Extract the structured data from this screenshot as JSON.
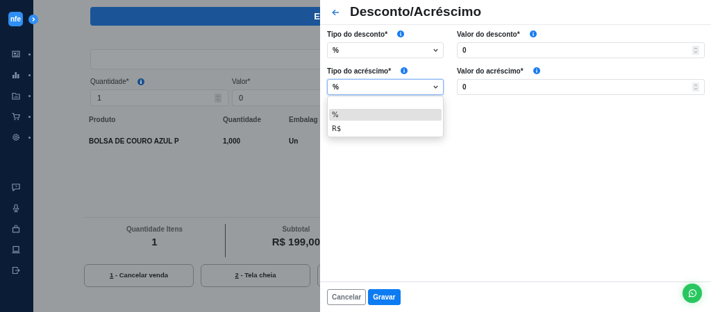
{
  "sidebar": {
    "logo": "nfe"
  },
  "background": {
    "banner_text": "E",
    "fields": [
      {
        "label": "Quantidade*",
        "info": true,
        "value": "1",
        "kind": "number"
      },
      {
        "label": "Valor*",
        "info": false,
        "value": "0",
        "kind": "text"
      }
    ],
    "table": {
      "columns": [
        "Produto",
        "Quantidade",
        "Embalag"
      ],
      "rows": [
        [
          "BOLSA DE COURO AZUL P",
          "1,000",
          "Un"
        ]
      ]
    },
    "summary": [
      {
        "label": "Quantidade Itens",
        "value": "1"
      },
      {
        "label": "Subtotal",
        "value": "R$ 199,00"
      }
    ],
    "actions": [
      {
        "shortcut": "1",
        "label": " - Cancelar venda"
      },
      {
        "shortcut": "2",
        "label": " - Tela cheia"
      }
    ]
  },
  "panel": {
    "title": "Desconto/Acréscimo",
    "fields": [
      {
        "label": "Tipo do desconto*",
        "kind": "select",
        "value": "%",
        "focused": false
      },
      {
        "label": "Valor do desconto*",
        "kind": "number",
        "value": "0",
        "focused": false
      },
      {
        "label": "Tipo do acréscimo*",
        "kind": "select",
        "value": "%",
        "focused": true,
        "options": [
          {
            "label": "%",
            "selected": true
          },
          {
            "label": "R$",
            "selected": false
          }
        ]
      },
      {
        "label": "Valor do acréscimo*",
        "kind": "number",
        "value": "0",
        "focused": false
      }
    ],
    "buttons": [
      {
        "label": "Cancelar",
        "kind": "secondary"
      },
      {
        "label": "Gravar",
        "kind": "primary"
      }
    ]
  }
}
